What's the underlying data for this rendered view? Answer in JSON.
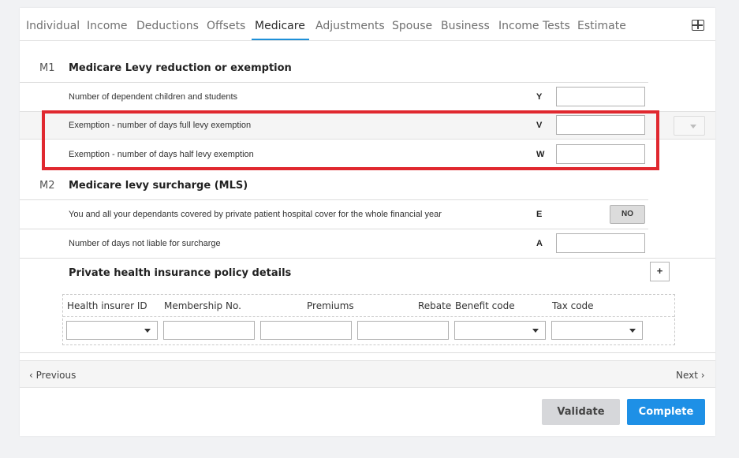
{
  "tabs": [
    {
      "label": "Individual"
    },
    {
      "label": "Income"
    },
    {
      "label": "Deductions"
    },
    {
      "label": "Offsets"
    },
    {
      "label": "Medicare"
    },
    {
      "label": "Adjustments"
    },
    {
      "label": "Spouse"
    },
    {
      "label": "Business"
    },
    {
      "label": "Income Tests"
    },
    {
      "label": "Estimate"
    }
  ],
  "active_tab": "Medicare",
  "layout_icon": "grid-icon",
  "m1": {
    "code": "M1",
    "title": "Medicare Levy reduction or exemption",
    "rows": [
      {
        "label": "Number of dependent children and students",
        "code": "Y",
        "value": ""
      },
      {
        "label": "Exemption - number of days full levy exemption",
        "code": "V",
        "value": ""
      },
      {
        "label": "Exemption - number of days half levy exemption",
        "code": "W",
        "value": ""
      }
    ]
  },
  "m2": {
    "code": "M2",
    "title": "Medicare levy surcharge (MLS)",
    "cover_row": {
      "label": "You and all your dependants covered by private patient hospital cover for the whole financial year",
      "code": "E",
      "toggle": "NO"
    },
    "days_row": {
      "label": "Number of days not liable for surcharge",
      "code": "A",
      "value": ""
    }
  },
  "policy": {
    "title": "Private health insurance policy details",
    "add_label": "+",
    "columns": [
      "Health insurer ID",
      "Membership No.",
      "Premiums",
      "Rebate",
      "Benefit code",
      "Tax code"
    ]
  },
  "nav": {
    "previous": "Previous",
    "next": "Next"
  },
  "actions": {
    "validate": "Validate",
    "complete": "Complete"
  },
  "colors": {
    "accent": "#1e90e6",
    "highlight": "#e0282f"
  }
}
